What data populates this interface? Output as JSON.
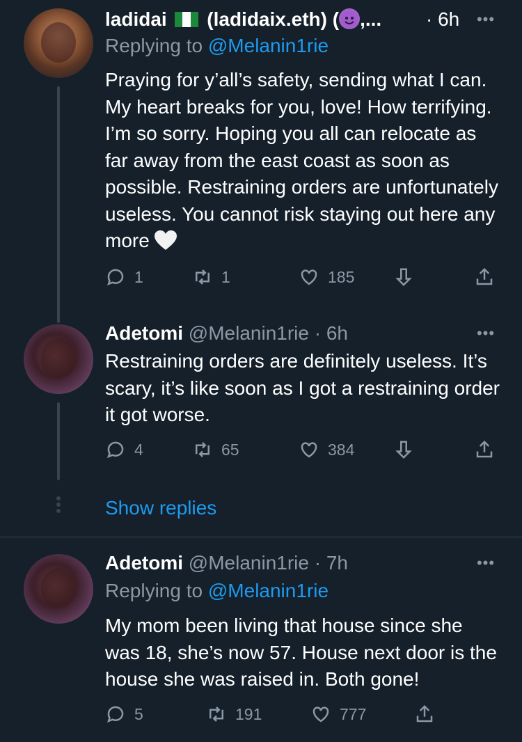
{
  "tweets": [
    {
      "name": "ladidai",
      "handle_rest": "(ladidaix.eth) (",
      "handle_tail": ",...",
      "time": "· 6h",
      "more": "•••",
      "replying_prefix": "Replying to ",
      "replying_to": "@Melanin1rie",
      "text": "Praying for y’all’s safety, sending what I can. My heart breaks for you, love! How terrifying. I’m so sorry. Hoping you all can relocate as far away from the east coast as soon as possible. Restraining orders are unfortunately useless. You cannot risk staying out here any more",
      "replies": "1",
      "retweets": "1",
      "likes": "185"
    },
    {
      "name": "Adetomi",
      "handle": "@Melanin1rie",
      "time": "· 6h",
      "more": "•••",
      "text": "Restraining orders are definitely useless. It’s scary, it’s like soon as I got a restraining order it got worse.",
      "replies": "4",
      "retweets": "65",
      "likes": "384"
    },
    {
      "name": "Adetomi",
      "handle": "@Melanin1rie",
      "time": "· 7h",
      "more": "•••",
      "replying_prefix": "Replying to ",
      "replying_to": "@Melanin1rie",
      "text": "My mom been living that house since she was 18, she’s now 57. House next door is the house she was raised in. Both gone!",
      "replies": "5",
      "retweets": "191",
      "likes": "777"
    }
  ],
  "show_replies": "Show replies",
  "icons": {
    "flag": "nigeria-flag-icon",
    "devil": "smiling-devil-emoji",
    "heart": "white-heart-emoji"
  },
  "colors": {
    "background": "#15202b",
    "link": "#1d9bf0",
    "muted": "#8b98a5",
    "divider": "#38444d"
  }
}
